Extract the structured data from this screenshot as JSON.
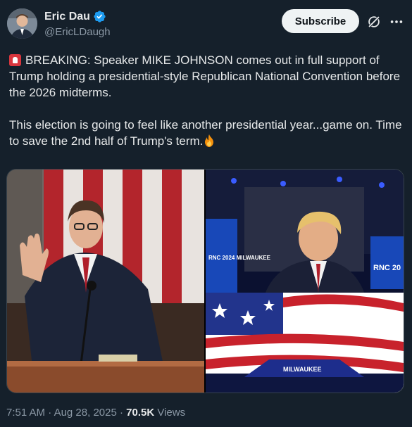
{
  "author": {
    "name": "Eric Dau",
    "handle": "@EricLDaugh",
    "verified": true
  },
  "actions": {
    "subscribe_label": "Subscribe",
    "grok_icon": "grok-icon",
    "more_icon": "more-icon"
  },
  "post": {
    "line1": "BREAKING: Speaker MIKE JOHNSON comes out in full support of Trump holding a presidential-style Republican National Convention before the 2026 midterms.",
    "line2": "This election is going to feel like another presidential year...game on. Time to save the 2nd half of Trump's term.",
    "emoji_start": "rotating-light-icon",
    "emoji_end": "fire-icon"
  },
  "media": {
    "right_sign_left": "RNC 2024 MILWAUKEE",
    "right_sign_right": "RNC 20",
    "podium_text": "MILWAUKEE"
  },
  "footer": {
    "time": "7:51 AM",
    "separator": "·",
    "date": "Aug 28, 2025",
    "views_count": "70.5K",
    "views_label": "Views"
  },
  "colors": {
    "background": "#15202b",
    "text": "#e7e9ea",
    "muted": "#8b98a5",
    "verified": "#1d9bf0"
  }
}
